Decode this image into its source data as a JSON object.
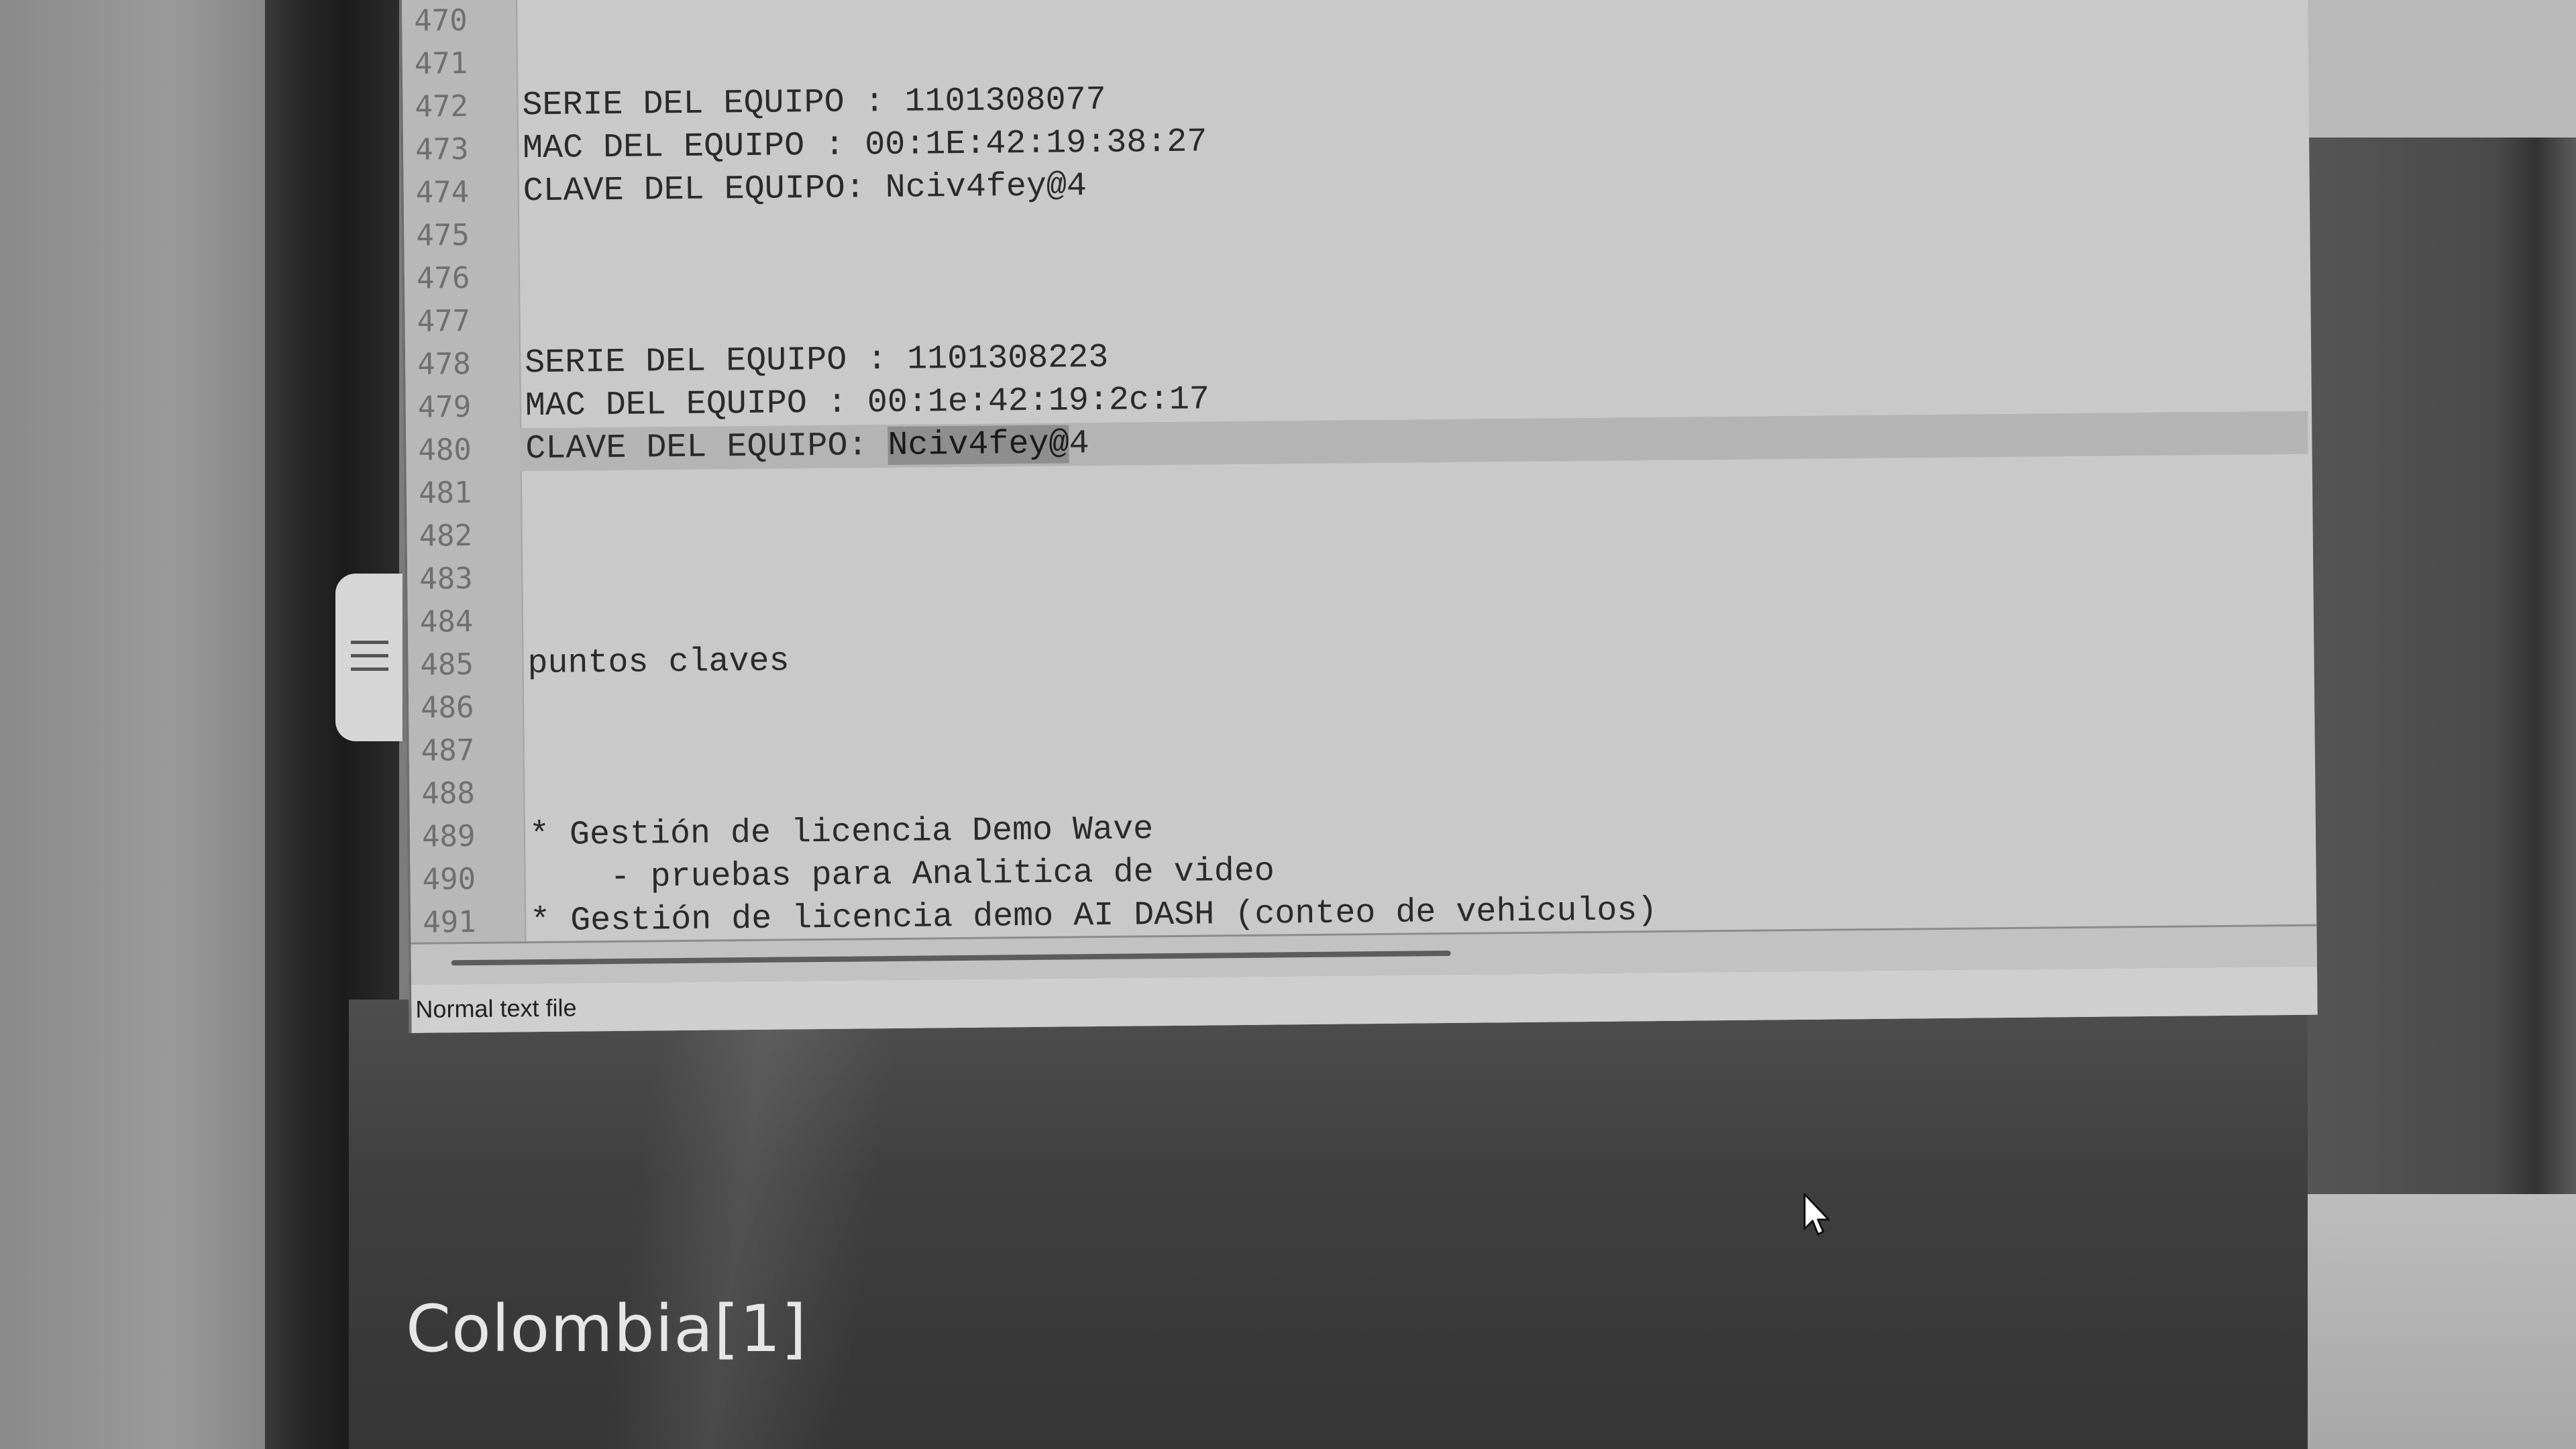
{
  "editor": {
    "lines": [
      {
        "num": "470",
        "text": ""
      },
      {
        "num": "471",
        "text": ""
      },
      {
        "num": "472",
        "text": "SERIE DEL EQUIPO : 1101308077"
      },
      {
        "num": "473",
        "text": "MAC DEL EQUIPO : 00:1E:42:19:38:27"
      },
      {
        "num": "474",
        "text": "CLAVE DEL EQUIPO: Nciv4fey@4"
      },
      {
        "num": "475",
        "text": ""
      },
      {
        "num": "476",
        "text": ""
      },
      {
        "num": "477",
        "text": ""
      },
      {
        "num": "478",
        "text": "SERIE DEL EQUIPO : 1101308223"
      },
      {
        "num": "479",
        "text": "MAC DEL EQUIPO : 00:1e:42:19:2c:17"
      },
      {
        "num": "480",
        "text_before": "CLAVE DEL EQUIPO: ",
        "text_selected": "Nciv4fey@",
        "text_after": "4"
      },
      {
        "num": "481",
        "text": ""
      },
      {
        "num": "482",
        "text": ""
      },
      {
        "num": "483",
        "text": ""
      },
      {
        "num": "484",
        "text": ""
      },
      {
        "num": "485",
        "text": "puntos claves"
      },
      {
        "num": "486",
        "text": ""
      },
      {
        "num": "487",
        "text": ""
      },
      {
        "num": "488",
        "text": ""
      },
      {
        "num": "489",
        "text": "* Gestión de licencia Demo Wave"
      },
      {
        "num": "490",
        "text": "    - pruebas para Analitica de video"
      },
      {
        "num": "491",
        "text": "* Gestión de licencia demo AI DASH (conteo de vehiculos)"
      }
    ]
  },
  "statusbar": {
    "file_type": "Normal text file"
  },
  "desktop": {
    "label": "Colombia[1]"
  },
  "side_panel": {
    "icon": "hamburger-menu-icon"
  },
  "pointer": {
    "icon": "mouse-pointer-icon"
  },
  "colors": {
    "editor_bg": "#c9c9c9",
    "gutter_bg": "#b8b8b8",
    "active_line": "#b4b4b4",
    "selection": "#8e8e8e"
  }
}
